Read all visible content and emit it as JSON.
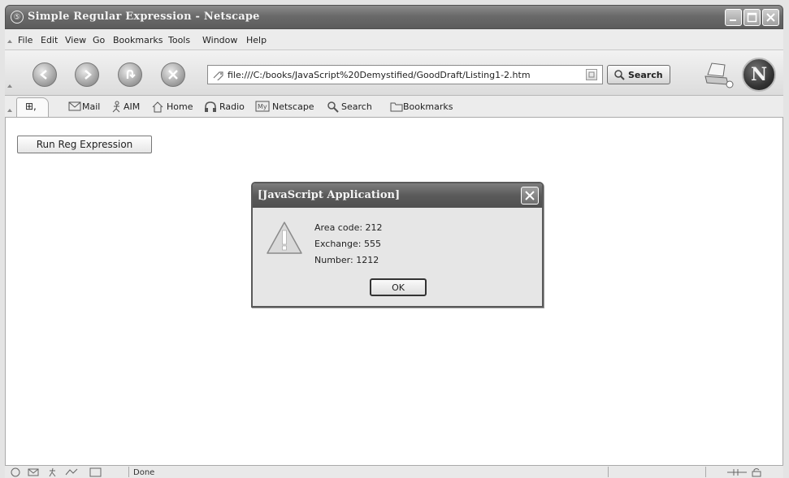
{
  "window": {
    "title": "Simple Regular Expression - Netscape"
  },
  "menubar": {
    "items": [
      "File",
      "Edit",
      "View",
      "Go",
      "Bookmarks",
      "Tools",
      "Window",
      "Help"
    ]
  },
  "navbar": {
    "url": "file:///C:/books/JavaScript%20Demystified/GoodDraft/Listing1-2.htm",
    "search_label": "Search",
    "buttons": [
      "back-icon",
      "forward-icon",
      "reload-icon",
      "stop-icon"
    ],
    "throbber_letter": "N"
  },
  "personal_toolbar": {
    "items": [
      "Mail",
      "AIM",
      "Home",
      "Radio",
      "Netscape",
      "Search",
      "Bookmarks"
    ]
  },
  "page": {
    "button_label": "Run Reg Expression"
  },
  "dialog": {
    "title": "[JavaScript Application]",
    "lines": [
      "Area code: 212",
      "Exchange: 555",
      "Number: 1212"
    ],
    "ok_label": "OK"
  },
  "statusbar": {
    "text": "Done"
  },
  "colors": {
    "titlebar": "#6a6a6a",
    "content_bg": "#ffffff"
  }
}
